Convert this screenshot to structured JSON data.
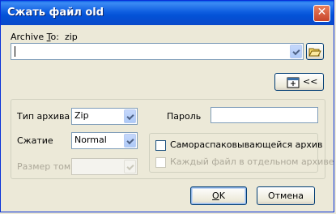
{
  "window": {
    "title": "Сжать файл old",
    "close_glyph": "✕"
  },
  "archive_to": {
    "label_prefix": "Archive ",
    "label_mnemonic": "T",
    "label_suffix": "o:",
    "format": "zip",
    "value": ""
  },
  "options_toggle": {
    "label": "<<",
    "icon": "archive-icon"
  },
  "archive_type": {
    "label": "Тип архива",
    "value": "Zip"
  },
  "compression": {
    "label": "Сжатие",
    "value": "Normal"
  },
  "volume_size": {
    "label": "Размер тома",
    "value": ""
  },
  "password": {
    "label": "Пароль",
    "value": ""
  },
  "self_extracting": {
    "label": "Самораспаковывающейся архив",
    "checked": false
  },
  "each_file_separate": {
    "label": "Каждый файл в отдельном архиве",
    "checked": false,
    "enabled": false
  },
  "buttons": {
    "ok_mnemonic": "O",
    "ok_rest": "K",
    "cancel": "Отмена"
  }
}
